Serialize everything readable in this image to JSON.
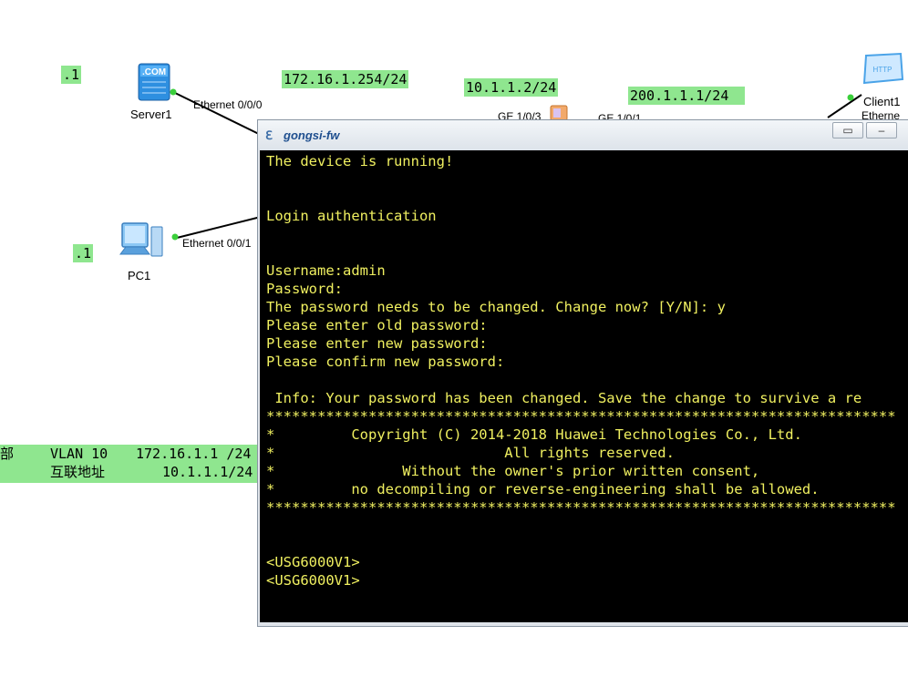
{
  "topology": {
    "labels": [
      ".1",
      "172.16.1.254/24",
      "10.1.1.2/24",
      "200.1.1.1/24",
      ".1"
    ],
    "devices": {
      "server": "Server1",
      "pc": "PC1",
      "client": "Client1"
    },
    "ports": {
      "server_port": "Ethernet 0/0/0",
      "pc_port": "Ethernet 0/0/1",
      "fw_port_a": "GE 1/0/3",
      "fw_port_b": "GE 1/0/1",
      "client_port": "Etherne"
    },
    "notes": {
      "row1_a": "部",
      "row1_b": "VLAN 10",
      "row1_c": "172.16.1.1 /24",
      "row2_a": "互联地址",
      "row2_b": "10.1.1.1/24"
    },
    "icons": {
      "server": "server-icon",
      "pc": "pc-icon",
      "firewall": "firewall-icon",
      "client": "http-client-icon"
    }
  },
  "window": {
    "title": "gongsi-fw",
    "minimize_label": "–",
    "restore_label": "▭"
  },
  "terminal": {
    "lines": [
      "The device is running!",
      "",
      "",
      "Login authentication",
      "",
      "",
      "Username:admin",
      "Password:",
      "The password needs to be changed. Change now? [Y/N]: y",
      "Please enter old password:",
      "Please enter new password:",
      "Please confirm new password:",
      "",
      " Info: Your password has been changed. Save the change to survive a re",
      "**************************************************************************",
      "*         Copyright (C) 2014-2018 Huawei Technologies Co., Ltd.",
      "*                           All rights reserved.",
      "*               Without the owner's prior written consent,",
      "*         no decompiling or reverse-engineering shall be allowed.",
      "**************************************************************************",
      "",
      "",
      "<USG6000V1>",
      "<USG6000V1>"
    ],
    "colors": {
      "background": "#000000",
      "text": "#f0f060"
    }
  }
}
